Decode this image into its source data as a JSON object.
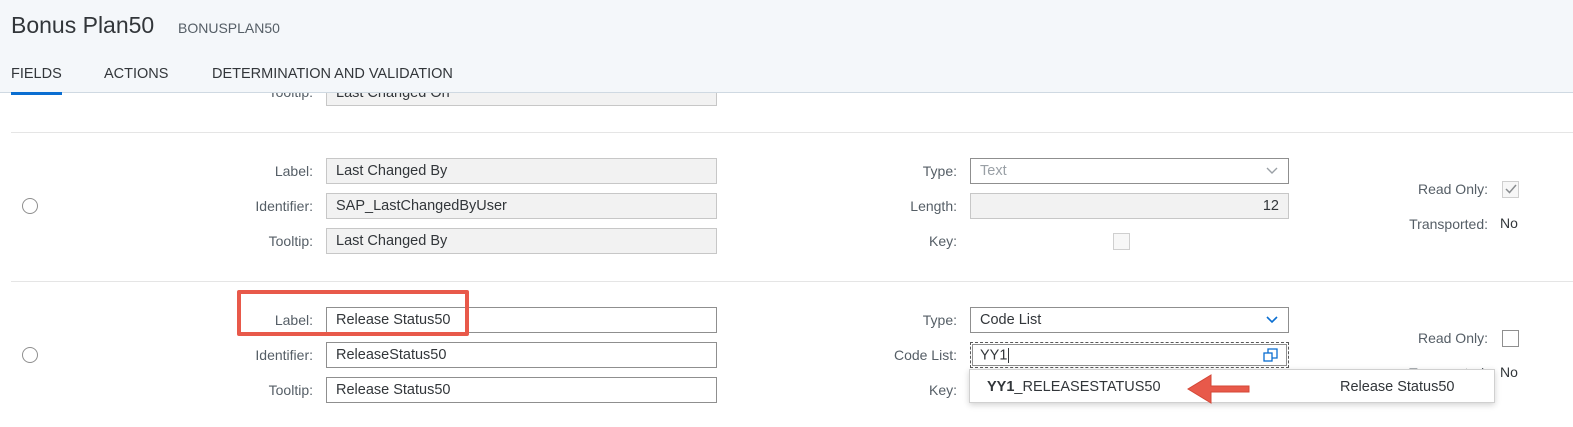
{
  "header": {
    "title": "Bonus Plan50",
    "subtitle": "BONUSPLAN50",
    "tabs": [
      {
        "label": "FIELDS",
        "active": true
      },
      {
        "label": "ACTIONS",
        "active": false
      },
      {
        "label": "DETERMINATION AND VALIDATION",
        "active": false
      }
    ]
  },
  "rows": [
    {
      "tooltip_label": "Tooltip:",
      "tooltip_value": "Last Changed On"
    },
    {
      "label_label": "Label:",
      "label_value": "Last Changed By",
      "identifier_label": "Identifier:",
      "identifier_value": "SAP_LastChangedByUser",
      "tooltip_label": "Tooltip:",
      "tooltip_value": "Last Changed By",
      "type_label": "Type:",
      "type_value": "Text",
      "length_label": "Length:",
      "length_value": "12",
      "key_label": "Key:",
      "read_only_label": "Read Only:",
      "read_only_checked": true,
      "transported_label": "Transported:",
      "transported_value": "No"
    },
    {
      "label_label": "Label:",
      "label_value": "Release Status50",
      "identifier_label": "Identifier:",
      "identifier_value": "ReleaseStatus50",
      "tooltip_label": "Tooltip:",
      "tooltip_value": "Release Status50",
      "type_label": "Type:",
      "type_value": "Code List",
      "code_list_label": "Code List:",
      "code_list_value": "YY1",
      "key_label": "Key:",
      "read_only_label": "Read Only:",
      "read_only_checked": false,
      "transported_label": "Transported:",
      "transported_value": "No"
    }
  ],
  "suggestion": {
    "match": "YY1",
    "rest": "_RELEASESTATUS50",
    "description": "Release Status50"
  },
  "colors": {
    "accent": "#0a6ed1",
    "highlight": "#e8594a",
    "header_bg": "#f4f7fa"
  }
}
